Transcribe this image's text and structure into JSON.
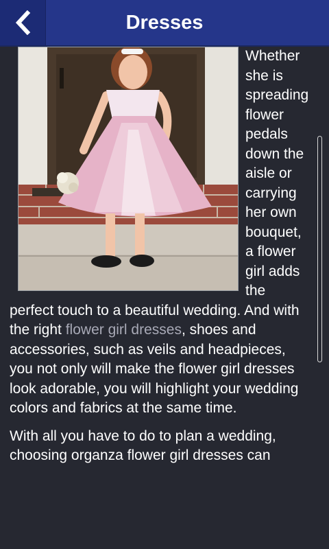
{
  "header": {
    "title": "Dresses",
    "back_icon": "chevron-left-icon"
  },
  "image": {
    "alt": "Flower girl in a pink tulle dress"
  },
  "article": {
    "p1_lead": "Whether she is spreading flower pedals down the aisle or carrying her own bouquet, a flower girl adds the perfect touch to a beautiful wedding. And with the right ",
    "p1_link": "flower girl dresses",
    "p1_tail": ", shoes and accessories, such as veils and headpieces, you not only will make the flower girl dresses look adorable, you will highlight your wedding colors and fabrics at the same time.",
    "p2": "With all you have to do to plan a wedding, choosing organza flower girl dresses can"
  },
  "colors": {
    "header_bg": "#25368a",
    "back_bg": "#1c2b75",
    "page_bg": "#262831",
    "link": "#a8a9b6"
  }
}
